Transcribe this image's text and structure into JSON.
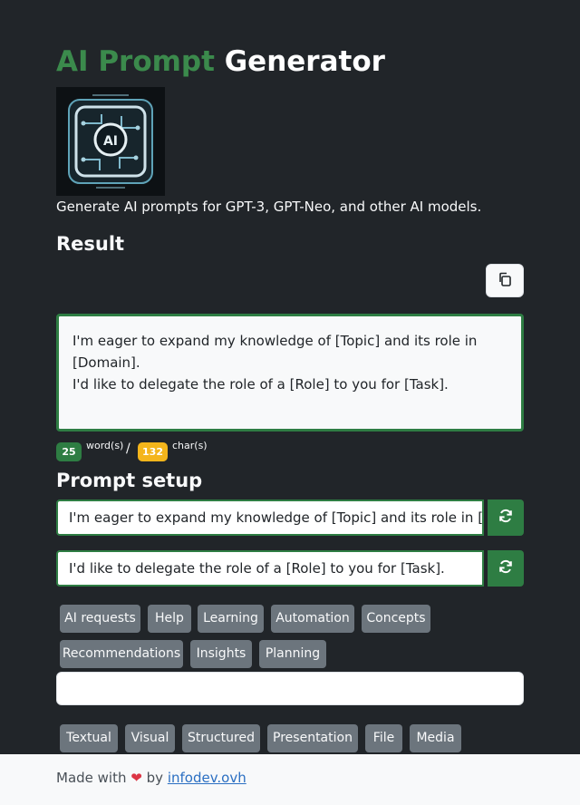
{
  "header": {
    "title_accent": "AI Prompt",
    "title_rest": "Generator",
    "tagline": "Generate AI prompts for GPT-3, GPT-Neo, and other AI models."
  },
  "result": {
    "heading": "Result",
    "lines": [
      "I'm eager to expand my knowledge of [Topic] and its role in [Domain].",
      "I'd like to delegate the role of a [Role] to you for [Task]."
    ],
    "word_count": "25",
    "word_unit": "word(s)",
    "char_count": "132",
    "char_unit": "char(s)",
    "separator": "/"
  },
  "setup": {
    "heading": "Prompt setup",
    "prompts": [
      {
        "value": "I'm eager to expand my knowledge of [Topic] and its role in [Domain]."
      },
      {
        "value": "I'd like to delegate the role of a [Role] to you for [Task]."
      }
    ],
    "category_tags": [
      "AI requests",
      "Help",
      "Learning",
      "Automation",
      "Concepts",
      "Recommendations",
      "Insights",
      "Planning"
    ],
    "format_tags": [
      "Textual",
      "Visual",
      "Structured",
      "Presentation",
      "File",
      "Media"
    ]
  },
  "footer": {
    "made_with": "Made with",
    "by": "by",
    "link": "infodev.ovh"
  },
  "colors": {
    "accent_green": "#2e7d43",
    "badge_yellow": "#f4b51b",
    "tag_gray": "#6c757d"
  }
}
